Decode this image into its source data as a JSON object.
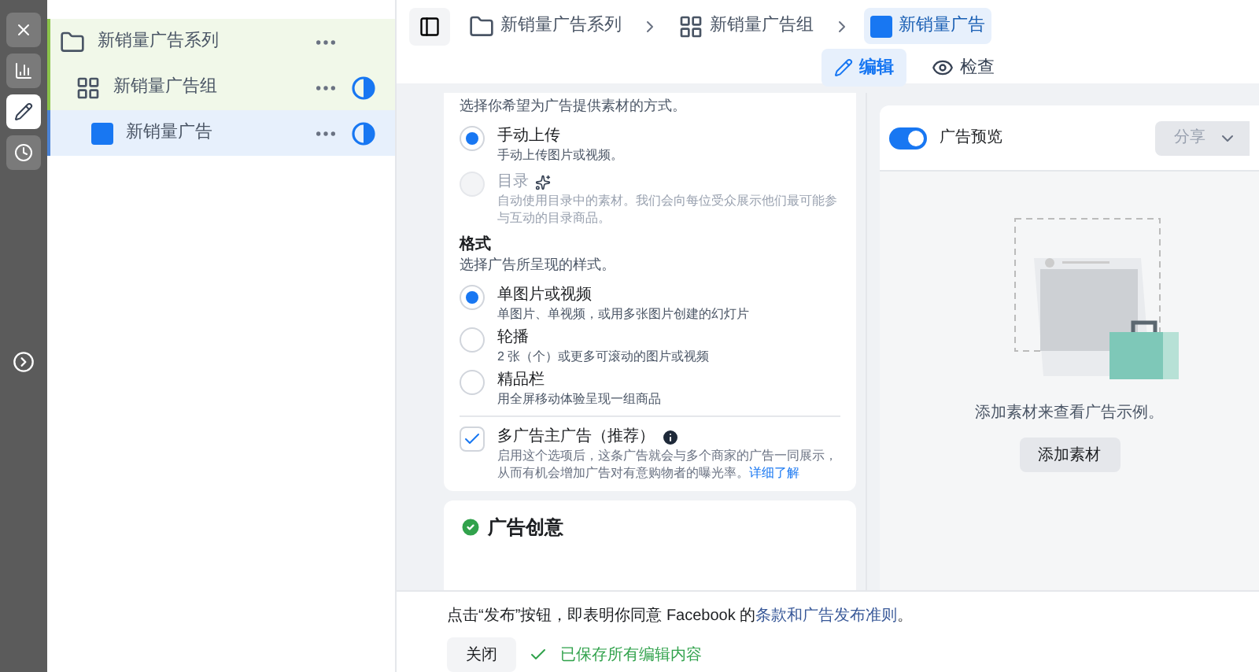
{
  "rail": [
    {
      "kind": "close",
      "selected": false
    },
    {
      "kind": "chart",
      "selected": false
    },
    {
      "kind": "edit",
      "selected": true
    },
    {
      "kind": "clock",
      "selected": false
    }
  ],
  "tree": [
    {
      "kind": "campaign",
      "label": "新销量广告系列",
      "selected": false,
      "status": false
    },
    {
      "kind": "adset",
      "label": "新销量广告组",
      "selected": false,
      "status": true
    },
    {
      "kind": "ad",
      "label": "新销量广告",
      "selected": true,
      "status": true
    }
  ],
  "breadcrumb": [
    {
      "kind": "campaign",
      "label": "新销量广告系列",
      "selected": false
    },
    {
      "kind": "adset",
      "label": "新销量广告组",
      "selected": false
    },
    {
      "kind": "ad",
      "label": "新销量广告",
      "selected": true
    }
  ],
  "mode_tabs": [
    {
      "kind": "edit",
      "label": "编辑",
      "selected": true
    },
    {
      "kind": "eye",
      "label": "检查",
      "selected": false
    }
  ],
  "source": {
    "hint": "选择你希望为广告提供素材的方式。",
    "options": [
      {
        "label": "手动上传",
        "description": "手动上传图片或视频。",
        "selected": true,
        "disabled": false,
        "sparkle": false
      },
      {
        "label": "目录",
        "description": "自动使用目录中的素材。我们会向每位受众展示他们最可能参与互动的目录商品。",
        "selected": false,
        "disabled": true,
        "sparkle": true
      }
    ]
  },
  "format": {
    "title": "格式",
    "hint": "选择广告所呈现的样式。",
    "options": [
      {
        "label": "单图片或视频",
        "description": "单图片、单视频，或用多张图片创建的幻灯片",
        "selected": true
      },
      {
        "label": "轮播",
        "description": "2 张（个）或更多可滚动的图片或视频",
        "selected": false
      },
      {
        "label": "精品栏",
        "description": "用全屏移动体验呈现一组商品",
        "selected": false
      }
    ]
  },
  "multi_advertiser": {
    "label": "多广告主广告（推荐）",
    "checked": true,
    "description": "启用这个选项后，这条广告就会与多个商家的广告一同展示，从而有机会增加广告对有意购物者的曝光率。",
    "link": "详细了解"
  },
  "creative_card": {
    "title": "广告创意",
    "complete": true
  },
  "preview": {
    "toggle_label": "广告预览",
    "on": true,
    "share": "分享",
    "empty_text": "添加素材来查看广告示例。",
    "add_button": "添加素材"
  },
  "footer": {
    "notice": "点击“发布”按钮，即表明你同意 Facebook 的",
    "link": "条款和广告发布准则",
    "notice_end": "。",
    "close": "关闭",
    "saved": "已保存所有编辑内容"
  }
}
